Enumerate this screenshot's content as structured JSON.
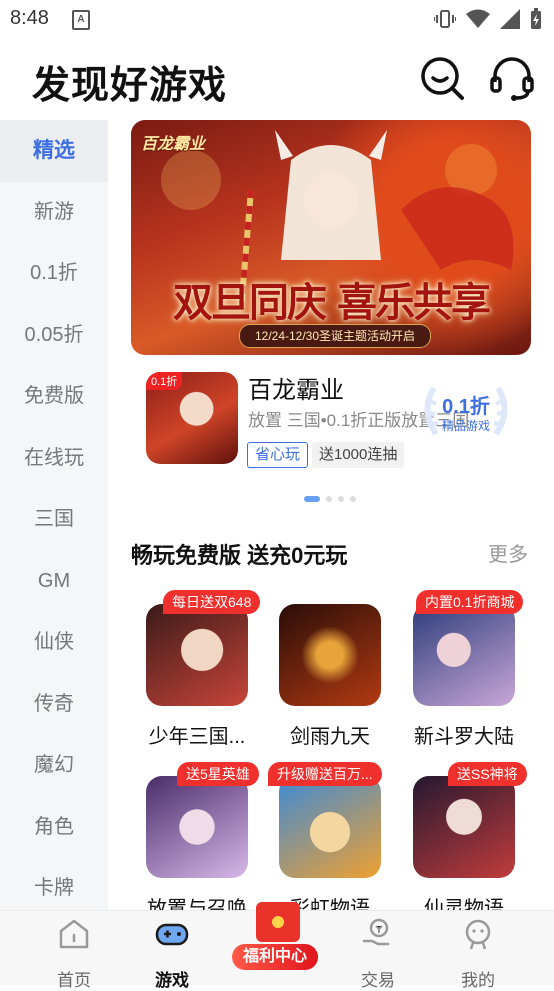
{
  "status_bar": {
    "time": "8:48",
    "notification_icon": "A"
  },
  "header": {
    "title": "发现好游戏",
    "search_icon": "search-icon",
    "service_icon": "headset-icon"
  },
  "sidebar": {
    "items": [
      {
        "label": "精选",
        "active": true
      },
      {
        "label": "新游"
      },
      {
        "label": "0.1折"
      },
      {
        "label": "0.05折"
      },
      {
        "label": "免费版"
      },
      {
        "label": "在线玩"
      },
      {
        "label": "三国"
      },
      {
        "label": "GM"
      },
      {
        "label": "仙侠"
      },
      {
        "label": "传奇"
      },
      {
        "label": "魔幻"
      },
      {
        "label": "角色"
      },
      {
        "label": "卡牌"
      }
    ]
  },
  "banner": {
    "logo_text": "百龙霸业",
    "headline": "双旦同庆 喜乐共享",
    "date_text": "12/24-12/30圣诞主题活动开启"
  },
  "featured": {
    "icon_tag": "0.1折",
    "name": "百龙霸业",
    "desc": "放置 三国•0.1折正版放置三国",
    "tag1": "省心玩",
    "tag2": "送1000连抽",
    "badge_big": "0.1折",
    "badge_small": "精品游戏"
  },
  "carousel": {
    "count": 4,
    "active_index": 0
  },
  "section": {
    "title": "畅玩免费版 送充0元玩",
    "more": "更多",
    "games": [
      {
        "name": "少年三国...",
        "ribbon": "每日送双648",
        "color1": "#3a1a18",
        "color2": "#c8453a"
      },
      {
        "name": "剑雨九天",
        "ribbon": "",
        "color1": "#2a0d08",
        "color2": "#b23a12"
      },
      {
        "name": "新斗罗大陆",
        "ribbon": "内置0.1折商城",
        "color1": "#2c3c7a",
        "color2": "#c9a7d8"
      },
      {
        "name": "放置与召唤",
        "ribbon": "送5星英雄",
        "color1": "#4a2c6a",
        "color2": "#d7b8e8"
      },
      {
        "name": "彩虹物语",
        "ribbon": "升级赠送百万...",
        "color1": "#3c8ad8",
        "color2": "#f0a030"
      },
      {
        "name": "仙灵物语",
        "ribbon": "送SS神将",
        "color1": "#251830",
        "color2": "#c13c3c"
      }
    ]
  },
  "bottom_nav": {
    "items": [
      {
        "label": "首页"
      },
      {
        "label": "游戏",
        "active": true
      },
      {
        "label": "交易"
      },
      {
        "label": "我的"
      }
    ],
    "welfare_label": "福利中心"
  },
  "colors": {
    "accent": "#3d6fe0",
    "ribbon_red": "#f0302d"
  }
}
